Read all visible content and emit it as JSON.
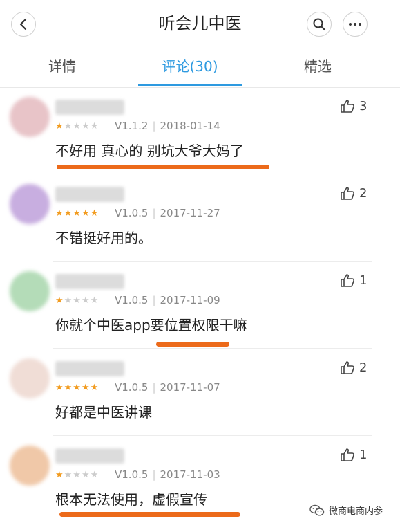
{
  "header": {
    "title": "听会儿中医",
    "back_icon": "chevron-left-icon",
    "search_icon": "search-icon",
    "more_icon": "more-dots-icon"
  },
  "tabs": [
    {
      "label": "详情",
      "active": false
    },
    {
      "label": "评论(30)",
      "active": true
    },
    {
      "label": "精选",
      "active": false
    }
  ],
  "colors": {
    "accent": "#2e9ae0",
    "star": "#f29b1e",
    "highlight": "#ec6a1a"
  },
  "reviews": [
    {
      "stars": 1,
      "version": "V1.1.2",
      "date": "2018-01-14",
      "text": "不好用 真心的 别坑大爷大妈了",
      "likes": "3"
    },
    {
      "stars": 5,
      "version": "V1.0.5",
      "date": "2017-11-27",
      "text": "不错挺好用的。",
      "likes": "2"
    },
    {
      "stars": 1,
      "version": "V1.0.5",
      "date": "2017-11-09",
      "text": "你就个中医app要位置权限干嘛",
      "likes": "1"
    },
    {
      "stars": 5,
      "version": "V1.0.5",
      "date": "2017-11-07",
      "text": "好都是中医讲课",
      "likes": "2"
    },
    {
      "stars": 1,
      "version": "V1.0.5",
      "date": "2017-11-03",
      "text": "根本无法使用，虚假宣传",
      "likes": "1"
    }
  ],
  "watermark": {
    "text": "微商电商内参",
    "icon": "wechat-icon"
  }
}
